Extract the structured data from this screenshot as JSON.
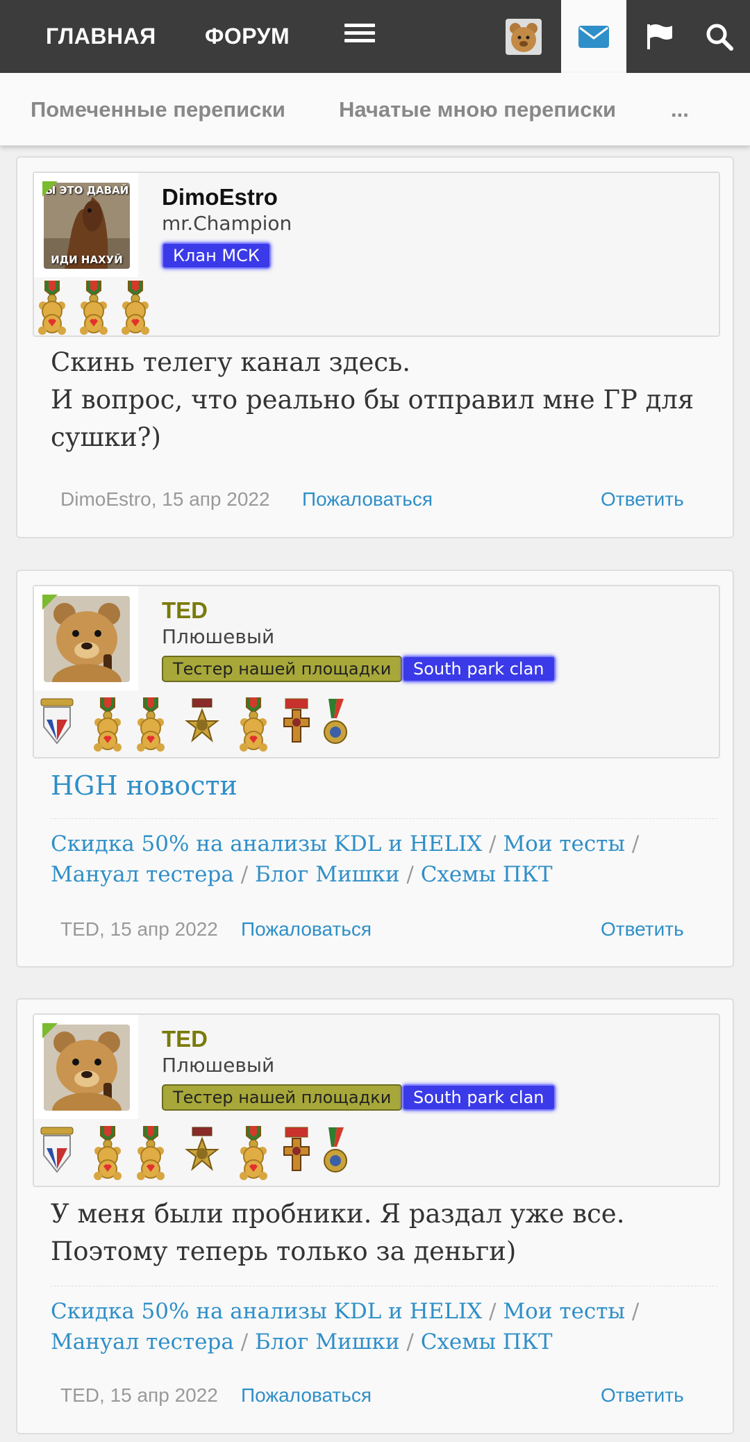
{
  "nav": {
    "home": "ГЛАВНАЯ",
    "forum": "ФОРУМ"
  },
  "subnav": {
    "starred": "Помеченные переписки",
    "started": "Начатые мною переписки",
    "more": "..."
  },
  "posts": [
    {
      "name": "DimoEstro",
      "name_color": "#111111",
      "title": "mr.Champion",
      "badges": [
        "Клан МСК"
      ],
      "message": [
        "Скинь телегу канал здесь.",
        "И вопрос, что реально бы отправил мне ГР для",
        "сушки?)"
      ],
      "author": "DimoEstro",
      "date": "15 апр 2022",
      "report": "Пожаловаться",
      "reply": "Ответить"
    },
    {
      "name": "TED",
      "name_color": "#7a7a0a",
      "title": "Плюшевый",
      "badges": [
        "Тестер нашей площадки",
        "South park clan"
      ],
      "message": [
        "HGH новости"
      ],
      "signature": [
        "Скидка 50% на анализы KDL и HELIX",
        "Мои тесты",
        "Мануал тестера",
        "Блог Мишки",
        "Схемы ПКТ"
      ],
      "author": "TED",
      "date": "15 апр 2022",
      "report": "Пожаловаться",
      "reply": "Ответить"
    },
    {
      "name": "TED",
      "name_color": "#7a7a0a",
      "title": "Плюшевый",
      "badges": [
        "Тестер нашей площадки",
        "South park clan"
      ],
      "message": [
        "У меня были пробники. Я раздал уже все.",
        "Поэтому теперь только за деньги)"
      ],
      "signature": [
        "Скидка 50% на анализы KDL и HELIX",
        "Мои тесты",
        "Мануал тестера",
        "Блог Мишки",
        "Схемы ПКТ"
      ],
      "author": "TED",
      "date": "15 апр 2022",
      "report": "Пожаловаться",
      "reply": "Ответить"
    }
  ],
  "avatar_text": {
    "top": "Ы ЭТО ДАВАЙ",
    "bottom": "ИДИ НАХУЙ"
  },
  "colors": {
    "topbar": "#3c3c3c",
    "link": "#2f8fc8",
    "clan_badge": "#3a3ae8",
    "tester_badge": "#a8a83a",
    "online": "#7cba2f"
  },
  "icons": {
    "menu": "hamburger-icon",
    "avatar": "user-avatar",
    "inbox": "envelope-icon",
    "alerts": "flag-icon",
    "search": "search-icon"
  }
}
